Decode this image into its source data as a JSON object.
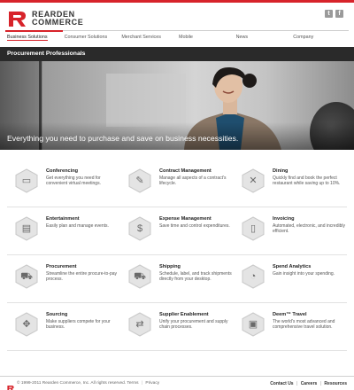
{
  "brand": {
    "line1": "REARDEN",
    "line2": "COMMERCE",
    "accent_color": "#d7232a"
  },
  "social": {
    "items": [
      {
        "icon": "twitter-icon",
        "glyph": "t"
      },
      {
        "icon": "facebook-icon",
        "glyph": "f"
      }
    ]
  },
  "nav": {
    "items": [
      {
        "label": "Business Solutions",
        "active": true
      },
      {
        "label": "Consumer Solutions",
        "active": false
      },
      {
        "label": "Merchant Services",
        "active": false
      },
      {
        "label": "Mobile",
        "active": false
      },
      {
        "label": "News",
        "active": false
      },
      {
        "label": "Company",
        "active": false
      }
    ]
  },
  "hero": {
    "title": "Procurement Professionals",
    "caption": "Everything you need to purchase and save on business necessities."
  },
  "services": [
    [
      {
        "title": "Conferencing",
        "desc": "Get everything you need for convenient virtual meetings.",
        "icon": "laptop-icon",
        "glyph": "▭"
      },
      {
        "title": "Contract Management",
        "desc": "Manage all aspects of a contract's lifecycle.",
        "icon": "pen-icon",
        "glyph": "✎"
      },
      {
        "title": "Dining",
        "desc": "Quickly find and book the perfect restaurant while saving up to 10%.",
        "icon": "utensils-icon",
        "glyph": "✕"
      }
    ],
    [
      {
        "title": "Entertainment",
        "desc": "Easily plan and manage events.",
        "icon": "film-icon",
        "glyph": "▤"
      },
      {
        "title": "Expense Management",
        "desc": "Save time and control expenditures.",
        "icon": "dollar-icon",
        "glyph": "$"
      },
      {
        "title": "Invoicing",
        "desc": "Automated, electronic, and incredibly efficient.",
        "icon": "invoice-icon",
        "glyph": "▯"
      }
    ],
    [
      {
        "title": "Procurement",
        "desc": "Streamline the entire procure-to-pay process.",
        "icon": "cart-icon",
        "glyph": "⛟"
      },
      {
        "title": "Shipping",
        "desc": "Schedule, label, and track shipments directly from your desktop.",
        "icon": "truck-icon",
        "glyph": "⛟"
      },
      {
        "title": "Spend Analytics",
        "desc": "Gain insight into your spending.",
        "icon": "pie-chart-icon",
        "glyph": "◔"
      }
    ],
    [
      {
        "title": "Sourcing",
        "desc": "Make suppliers compete for your business.",
        "icon": "arrows-icon",
        "glyph": "✥"
      },
      {
        "title": "Supplier Enablement",
        "desc": "Unify your procurement and supply chain processes.",
        "icon": "exchange-icon",
        "glyph": "⇄"
      },
      {
        "title": "Deem™ Travel",
        "desc": "The world's most advanced and comprehensive travel solution.",
        "icon": "suitcase-icon",
        "glyph": "▣"
      }
    ]
  ],
  "footer": {
    "copyright": "© 1999-2011 Rearden Commerce, Inc. All rights reserved.",
    "terms": "Terms",
    "privacy": "Privacy",
    "contact": "Contact Us",
    "careers": "Careers",
    "resources": "Resources"
  }
}
